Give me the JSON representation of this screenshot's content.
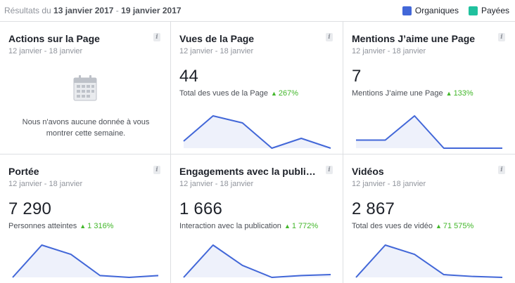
{
  "header": {
    "prefix": "Résultats du",
    "start": "13 janvier 2017",
    "dash": "-",
    "end": "19 janvier 2017",
    "legend": [
      {
        "label": "Organiques",
        "color": "#4267d8"
      },
      {
        "label": "Payées",
        "color": "#20c19e"
      }
    ]
  },
  "cards": [
    {
      "title": "Actions sur la Page",
      "period": "12 janvier - 18 janvier",
      "empty_line1": "Nous n'avons aucune donnée à vous",
      "empty_line2": "montrer cette semaine."
    },
    {
      "title": "Vues de la Page",
      "period": "12 janvier - 18 janvier",
      "value": "44",
      "metric_label": "Total des vues de la Page",
      "change": "267%",
      "trend": [
        1,
        10,
        7.5,
        -1.5,
        2,
        -1.5
      ]
    },
    {
      "title": "Mentions J’aime une Page",
      "period": "12 janvier - 18 janvier",
      "value": "7",
      "metric_label": "Mentions J’aime une Page",
      "change": "133%",
      "trend": [
        1,
        1,
        4,
        0,
        0,
        0
      ]
    },
    {
      "title": "Portée",
      "period": "12 janvier - 18 janvier",
      "value": "7 290",
      "metric_label": "Personnes atteintes",
      "change": "1 316%",
      "trend": [
        0,
        3.5,
        2.5,
        0.2,
        0,
        0.2
      ]
    },
    {
      "title": "Engagements avec la publica...",
      "period": "12 janvier - 18 janvier",
      "value": "1 666",
      "metric_label": "Interaction avec la publication",
      "change": "1 772%",
      "trend": [
        0,
        3.5,
        1.3,
        0,
        0.2,
        0.3
      ]
    },
    {
      "title": "Vidéos",
      "period": "12 janvier - 18 janvier",
      "value": "2 867",
      "metric_label": "Total des vues de vidéo",
      "change": "71 575%",
      "trend": [
        0,
        3.5,
        2.5,
        0.3,
        0.1,
        0
      ]
    }
  ]
}
